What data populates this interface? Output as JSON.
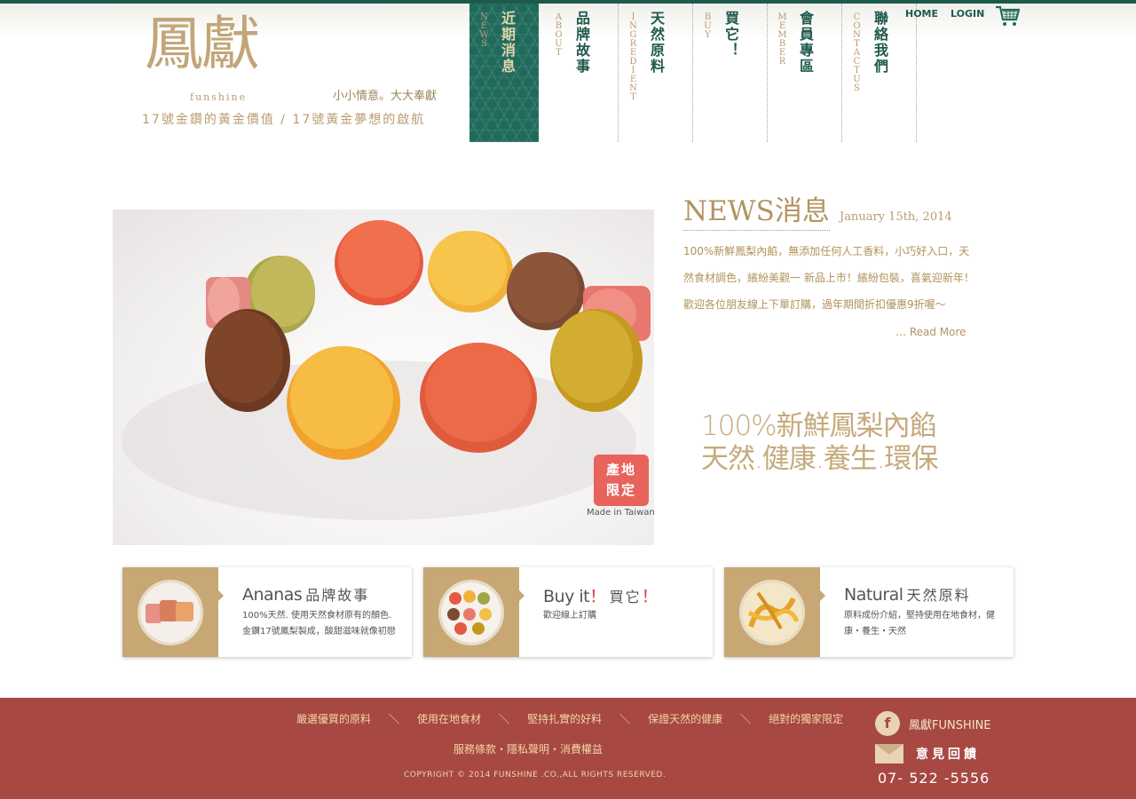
{
  "brand": {
    "logo_cn": "鳳獻",
    "logo_en": "funshine",
    "slogan_short": "小小情意。大大奉獻",
    "slogan_long": "17號金鑽的黃金價值 / 17號黃金夢想的啟航"
  },
  "nav": [
    {
      "en": "NEWS",
      "cn": "近期消息",
      "active": true
    },
    {
      "en": "ABOUT",
      "cn": "品牌故事",
      "active": false
    },
    {
      "en": "INGREDIENT",
      "cn": "天然原料",
      "active": false
    },
    {
      "en": "BUY",
      "cn": "買它！",
      "active": false
    },
    {
      "en": "MEMBER",
      "cn": "會員專區",
      "active": false
    },
    {
      "en": "CONTACTUS",
      "cn": "聯絡我們",
      "active": false
    }
  ],
  "top_links": {
    "home": "HOME",
    "login": "LOGIN",
    "cart_icon": "shopping-cart-icon"
  },
  "hero": {
    "stamp_line1": "產地",
    "stamp_line2": "限定",
    "made_in": "Made in Taiwan"
  },
  "news": {
    "title": "NEWS消息",
    "date": "January  15th,  2014",
    "body": "100%新鮮鳳梨內餡，無添加任何人工香料，小巧好入口，天然食材調色，繽紛美觀一 新品上市！繽紛包裝，喜氣迎新年！歡迎各位朋友線上下單訂購，過年期間折扣優惠9折喔～",
    "read_more": "… Read More"
  },
  "tagline": {
    "line1": "100%新鮮鳳梨內餡",
    "line2": "天然.健康.養生.環保"
  },
  "cards": [
    {
      "title_en": "Ananas",
      "title_cn": "品牌故事",
      "desc": "100%天然. 使用天然食材原有的顏色. 金鑽17號鳳梨製成，酸甜滋味就像初戀"
    },
    {
      "title_en": "Buy it",
      "excl": "！",
      "title_cn": "買它",
      "excl2": "！",
      "desc": "歡迎線上訂購"
    },
    {
      "title_en": "Natural",
      "title_cn": "天然原料",
      "desc": "原料成份介紹，堅持使用在地食材，健康・養生・天然"
    }
  ],
  "footer": {
    "links": [
      "嚴選優質的原料",
      "使用在地食材",
      "堅持扎實的好料",
      "保證天然的健康",
      "絕對的獨家限定"
    ],
    "separator": "＼",
    "policy": "服務條款・隱私聲明・消費權益",
    "copyright": "COPYRIGHT © 2014  FUNSHINE .CO.,ALL RIGHTS RESERVED.",
    "facebook_label": "鳳獻FUNSHINE",
    "feedback_label": "意見回饋",
    "phone": "07- 522 -5556"
  },
  "colors": {
    "accent_green": "#1f6a5b",
    "gold": "#c2a678",
    "footer_red": "#a74842"
  }
}
